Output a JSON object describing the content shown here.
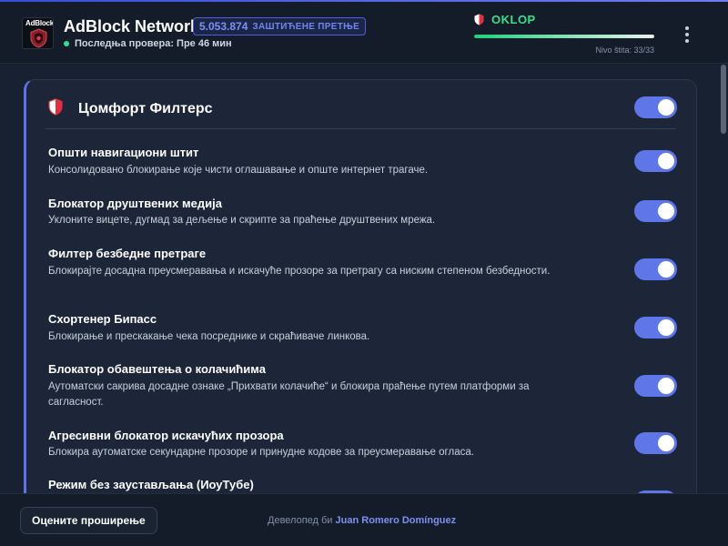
{
  "header": {
    "logo_text": "AdBlock",
    "title": "AdBlock Network",
    "blocked_count": "5.053.874",
    "blocked_label": "ЗАШТИЋЕНЕ ПРЕТЊЕ",
    "last_check": "Последња провера: Пре 46 мин",
    "shield_label": "OKLOP",
    "shield_level_text": "Nivo štita: 33/33",
    "shield_level": {
      "current": 33,
      "max": 33
    }
  },
  "card": {
    "title": "Цомфорт Филтерс",
    "master_toggle_on": true,
    "filters": [
      {
        "title": "Општи навигациони штит",
        "description": "Консолидовано блокирање које чисти оглашавање и опште интернет трагаче.",
        "enabled": true
      },
      {
        "title": "Блокатор друштвених медија",
        "description": "Уклоните вицете, дугмад за дељење и скрипте за праћење друштвених мрежа.",
        "enabled": true
      },
      {
        "title": "Филтер безбедне претраге",
        "description": "Блокирајте досадна преусмеравања и искачуће прозоре за претрагу са ниским степеном безбедности.",
        "enabled": true
      },
      {
        "title": "Схортенер Бипасс",
        "description": "Блокирање и прескакање чека посреднике и скраћиваче линкова.",
        "enabled": true
      },
      {
        "title": "Блокатор обавештења о колачићима",
        "description": "Аутоматски сакрива досадне ознаке „Прихвати колачиће“ и блокира праћење путем платформи за сагласност.",
        "enabled": true
      },
      {
        "title": "Агресивни блокатор искачућих прозора",
        "description": "Блокира аутоматске секундарне прозоре и принудне кодове за преусмеравање огласа.",
        "enabled": true
      },
      {
        "title": "Режим без заустављања (ИоуТубе)",
        "description": "",
        "enabled": true
      }
    ]
  },
  "footer": {
    "rate_button": "Оцените проширење",
    "dev_prefix": "Девелопед би",
    "dev_name": "Juan Romero Domínguez"
  },
  "colors": {
    "accent": "#5f76e8",
    "status_green": "#34e08b",
    "background": "#172131",
    "card": "#1c2638"
  },
  "icons": {
    "logo": "shield-logo-icon",
    "status": "shield-icon",
    "card": "shield-icon",
    "menu": "kebab-menu-icon"
  }
}
